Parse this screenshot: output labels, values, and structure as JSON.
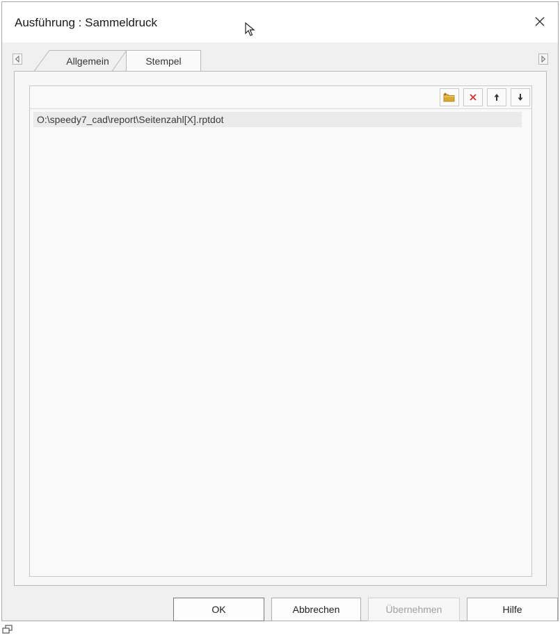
{
  "dialog": {
    "title": "Ausführung : Sammeldruck",
    "close_label": "×"
  },
  "tabs": [
    {
      "label": "Allgemein",
      "active": false
    },
    {
      "label": "Stempel",
      "active": true
    }
  ],
  "stamp_list": {
    "toolbar_icons": [
      "add-folder-icon",
      "delete-icon",
      "move-up-icon",
      "move-down-icon"
    ],
    "items": [
      "O:\\speedy7_cad\\report\\Seitenzahl[X].rptdot"
    ]
  },
  "buttons": {
    "ok": "OK",
    "cancel": "Abbrechen",
    "apply": "Übernehmen",
    "help": "Hilfe"
  },
  "colors": {
    "delete": "#d03030",
    "folder": "#d9a830"
  }
}
